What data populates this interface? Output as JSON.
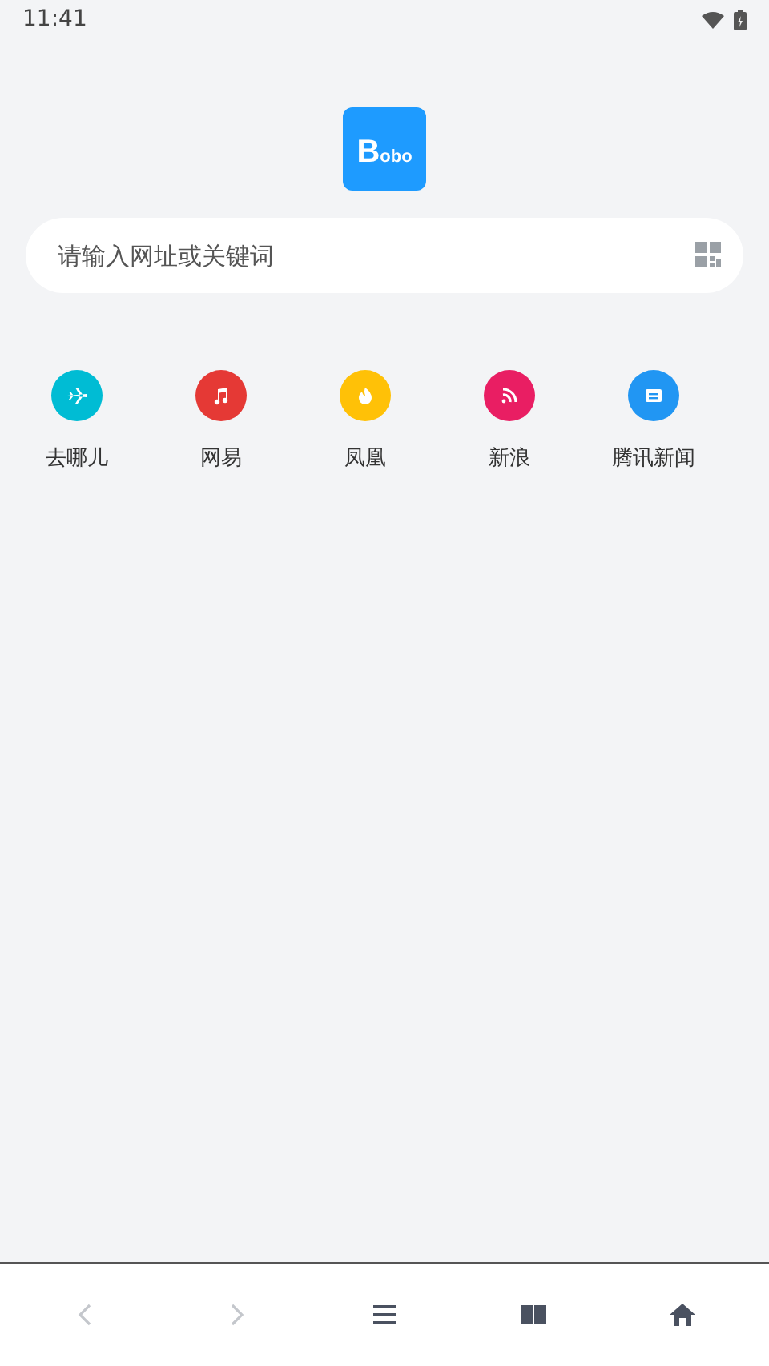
{
  "status_bar": {
    "time": "11:41"
  },
  "logo": {
    "text": "Bobo"
  },
  "search": {
    "placeholder": "请输入网址或关键词"
  },
  "shortcuts": [
    {
      "label": "去哪儿",
      "kind": "plane",
      "color": "#00bcd4"
    },
    {
      "label": "网易",
      "kind": "music",
      "color": "#e53935"
    },
    {
      "label": "凤凰",
      "kind": "fire",
      "color": "#ffc107"
    },
    {
      "label": "新浪",
      "kind": "rss",
      "color": "#e91e63"
    },
    {
      "label": "腾讯新闻",
      "kind": "news",
      "color": "#2196f3"
    }
  ],
  "bottom_nav": [
    {
      "kind": "back",
      "disabled": true
    },
    {
      "kind": "forward",
      "disabled": true
    },
    {
      "kind": "menu",
      "disabled": false
    },
    {
      "kind": "book",
      "disabled": false
    },
    {
      "kind": "home",
      "disabled": false
    }
  ]
}
